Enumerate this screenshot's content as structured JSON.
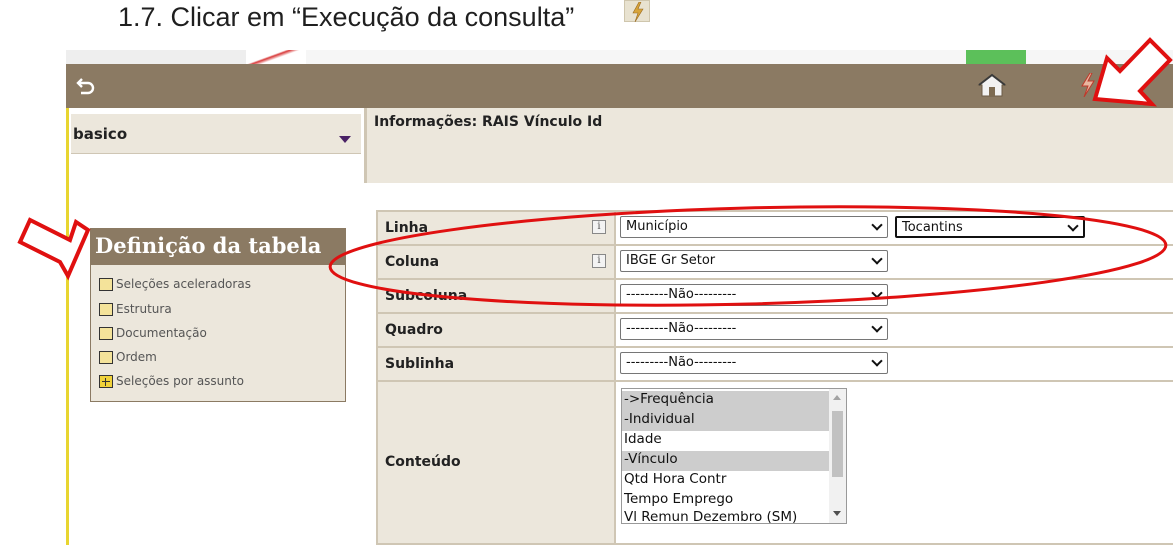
{
  "instruction": {
    "text": "1.7. Clicar em “Execução da consulta”",
    "icon": "lightning-icon"
  },
  "toolbar": {
    "back_icon": "back-arrow-icon",
    "home_icon": "house-icon",
    "execute_icon": "lightning-icon"
  },
  "sidebar": {
    "profile_select": {
      "value": "basico"
    },
    "definition": {
      "title": "Definição da tabela",
      "items": [
        {
          "label": "Seleções aceleradoras"
        },
        {
          "label": "Estrutura"
        },
        {
          "label": "Documentação"
        },
        {
          "label": "Ordem"
        },
        {
          "label": "Seleções por assunto"
        }
      ]
    }
  },
  "main": {
    "info_title": "Informações: RAIS Vínculo Id",
    "rows": [
      {
        "label": "Linha",
        "select": "Município",
        "extra_select": "Tocantins"
      },
      {
        "label": "Coluna",
        "select": "IBGE Gr Setor"
      },
      {
        "label": "Subcoluna",
        "select": "---------Não---------"
      },
      {
        "label": "Quadro",
        "select": "---------Não---------"
      },
      {
        "label": "Sublinha",
        "select": "---------Não---------"
      }
    ],
    "content": {
      "label": "Conteúdo",
      "options": [
        {
          "text": "->Frequência",
          "selected": true
        },
        {
          "text": "-Individual",
          "selected": true
        },
        {
          "text": "Idade",
          "selected": false
        },
        {
          "text": "-Vínculo",
          "selected": true
        },
        {
          "text": "Qtd Hora Contr",
          "selected": false
        },
        {
          "text": "Tempo Emprego",
          "selected": false
        },
        {
          "text": "Vl Remun Dezembro (SM)",
          "selected": false
        }
      ]
    }
  },
  "annotations": {
    "color": "#e01010",
    "shapes": [
      "arrow-to-execute-button",
      "arrow-to-definition-box",
      "ellipse-around-linha-coluna"
    ]
  }
}
